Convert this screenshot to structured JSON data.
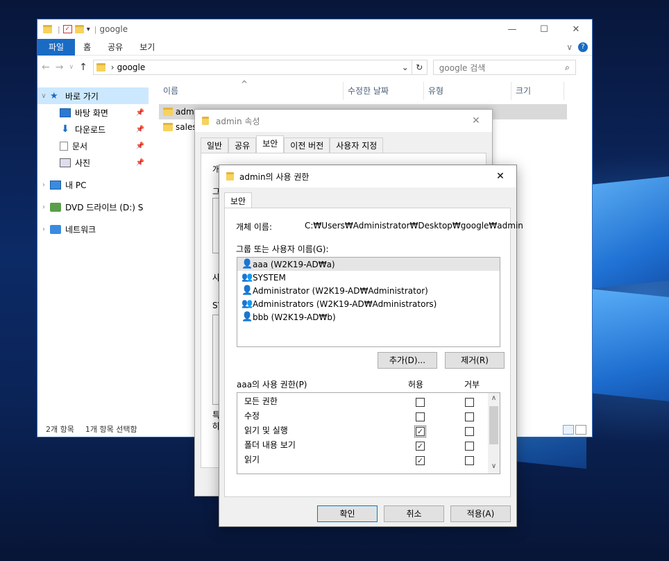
{
  "explorer": {
    "title": "google",
    "ribbon": {
      "file": "파일",
      "home": "홈",
      "share": "공유",
      "view": "보기"
    },
    "address": {
      "path": "google",
      "search_placeholder": "google 검색"
    },
    "nav": {
      "quick_access": "바로 가기",
      "desktop": "바탕 화면",
      "downloads": "다운로드",
      "documents": "문서",
      "pictures": "사진",
      "this_pc": "내 PC",
      "dvd": "DVD 드라이브 (D:) S",
      "network": "네트워크"
    },
    "columns": {
      "name": "이름",
      "modified": "수정한 날짜",
      "type": "유형",
      "size": "크기"
    },
    "files": [
      {
        "name": "adm"
      },
      {
        "name": "sales"
      }
    ],
    "status": {
      "count": "2개 항목",
      "selected": "1개 항목 선택함"
    }
  },
  "props_dialog": {
    "title": "admin 속성",
    "tabs": [
      "일반",
      "공유",
      "보안",
      "이전 버전",
      "사용자 지정"
    ],
    "peek": [
      "개",
      "그",
      "사",
      "SY",
      "특",
      "하"
    ]
  },
  "perm_dialog": {
    "title": "admin의 사용 권한",
    "tab": "보안",
    "object_label": "개체 이름:",
    "object_path": "C:₩Users₩Administrator₩Desktop₩google₩admin",
    "group_label": "그룹 또는 사용자 이름(G):",
    "users": [
      {
        "name": "aaa (W2K19-AD₩a)"
      },
      {
        "name": "SYSTEM"
      },
      {
        "name": "Administrator (W2K19-AD₩Administrator)"
      },
      {
        "name": "Administrators (W2K19-AD₩Administrators)"
      },
      {
        "name": "bbb (W2K19-AD₩b)"
      }
    ],
    "add_button": "추가(D)...",
    "remove_button": "제거(R)",
    "perm_label": "aaa의 사용 권한(P)",
    "allow_header": "허용",
    "deny_header": "거부",
    "permissions": [
      {
        "name": "모든 권한",
        "allow": false,
        "deny": false
      },
      {
        "name": "수정",
        "allow": false,
        "deny": false
      },
      {
        "name": "읽기 및 실행",
        "allow": true,
        "deny": false
      },
      {
        "name": "폴더 내용 보기",
        "allow": true,
        "deny": false
      },
      {
        "name": "읽기",
        "allow": true,
        "deny": false
      }
    ],
    "ok_button": "확인",
    "cancel_button": "취소",
    "apply_button": "적용(A)"
  },
  "colors": {
    "accent": "#1a6bc4",
    "selection": "#cce8ff",
    "folder": "#f7d25d"
  }
}
